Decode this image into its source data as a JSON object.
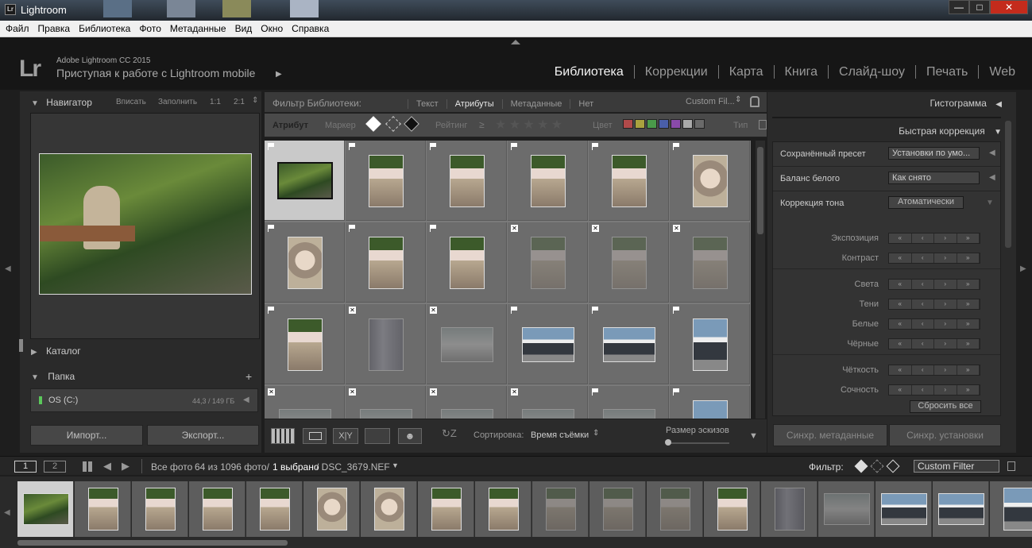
{
  "window": {
    "title": "Lightroom",
    "logo": "Lr"
  },
  "menu": [
    "Файл",
    "Правка",
    "Библиотека",
    "Фото",
    "Метаданные",
    "Вид",
    "Окно",
    "Справка"
  ],
  "identity": {
    "logo": "Lr",
    "product": "Adobe Lightroom CC 2015",
    "subtitle": "Приступая к работе с Lightroom mobile"
  },
  "modules": {
    "items": [
      "Библиотека",
      "Коррекции",
      "Карта",
      "Книга",
      "Слайд-шоу",
      "Печать",
      "Web"
    ],
    "active": "Библиотека"
  },
  "navigator": {
    "title": "Навигатор",
    "options": [
      "Вписать",
      "Заполнить",
      "1:1",
      "2:1"
    ]
  },
  "catalog": {
    "title": "Каталог"
  },
  "folders": {
    "title": "Папка",
    "disk_name": "OS (C:)",
    "disk_size": "44,3 / 149 ГБ"
  },
  "left_buttons": {
    "import": "Импорт...",
    "export": "Экспорт..."
  },
  "filter_bar": {
    "title": "Фильтр Библиотеки:",
    "tabs": [
      "Текст",
      "Атрибуты",
      "Метаданные",
      "Нет"
    ],
    "active_tab": "Атрибуты",
    "preset": "Custom Fil...",
    "attr_label": "Атрибут",
    "marker_label": "Маркер",
    "rating_label": "Рейтинг",
    "rating_op": "≥",
    "color_label": "Цвет",
    "type_label": "Тип",
    "colors": [
      "#b14a4a",
      "#a9a23f",
      "#4a9a4a",
      "#4a5fa9",
      "#8a4aa9",
      "#aaaaaa",
      "#6a6a6a"
    ]
  },
  "grid": {
    "rows": [
      [
        {
          "p": "landscape",
          "sel": true,
          "f": "flag"
        },
        {
          "p": "portrait",
          "f": "flag"
        },
        {
          "p": "portrait",
          "f": "flag"
        },
        {
          "p": "portrait",
          "f": "flag"
        },
        {
          "p": "portrait",
          "f": "flag"
        },
        {
          "p": "face",
          "f": "flag"
        }
      ],
      [
        {
          "p": "face",
          "f": "flag"
        },
        {
          "p": "portrait",
          "f": "flag"
        },
        {
          "p": "portrait",
          "f": "flag"
        },
        {
          "p": "portrait",
          "f": "rej",
          "dim": true
        },
        {
          "p": "portrait",
          "f": "rej",
          "dim": true
        },
        {
          "p": "portrait",
          "f": "rej",
          "dim": true
        }
      ],
      [
        {
          "p": "portrait",
          "f": "flag"
        },
        {
          "p": "blur",
          "f": "rej",
          "dim": true
        },
        {
          "p": "wide",
          "f": "rej",
          "dim": true
        },
        {
          "p": "car",
          "f": "flag"
        },
        {
          "p": "car",
          "f": "flag"
        },
        {
          "p": "carp",
          "f": "flag"
        }
      ],
      [
        {
          "p": "wide",
          "f": "rej",
          "dim": true
        },
        {
          "p": "wide",
          "f": "rej",
          "dim": true
        },
        {
          "p": "wide",
          "f": "rej",
          "dim": true
        },
        {
          "p": "wide",
          "f": "rej",
          "dim": true
        },
        {
          "p": "wide",
          "f": "flag",
          "dim": true
        },
        {
          "p": "carp",
          "f": "flag"
        }
      ]
    ]
  },
  "toolbar": {
    "sort_label": "Сортировка:",
    "sort_value": "Время съёмки",
    "thumb_label": "Размер эскизов",
    "view_xy": "X|Y"
  },
  "right": {
    "histogram": "Гистограмма",
    "quick_dev": "Быстрая коррекция",
    "saved_preset_label": "Сохранённый пресет",
    "saved_preset_value": "Установки по умо...",
    "wb_label": "Баланс белого",
    "wb_value": "Как снято",
    "tone_label": "Коррекция тона",
    "auto_button": "Атоматически",
    "sliders": [
      "Экспозиция",
      "Контраст",
      "Света",
      "Тени",
      "Белые",
      "Чёрные",
      "Чёткость",
      "Сочность"
    ],
    "reset": "Сбросить все",
    "sync_meta": "Синхр. метаданные",
    "sync_settings": "Синхр. установки"
  },
  "filmstrip_bar": {
    "page1": "1",
    "page2": "2",
    "source": "Все фото",
    "count": "64 из 1096 фото/",
    "selected": "1 выбрано",
    "filename": "/ DSC_3679.NEF",
    "filter_label": "Фильтр:",
    "filter_value": "Custom Filter"
  },
  "filmstrip": [
    "landscape",
    "portrait",
    "portrait",
    "portrait",
    "portrait",
    "face",
    "face",
    "portrait",
    "portrait",
    "portraitdim",
    "portraitdim",
    "portraitdim",
    "portrait",
    "blurdim",
    "widedim",
    "car",
    "car",
    "carp"
  ]
}
